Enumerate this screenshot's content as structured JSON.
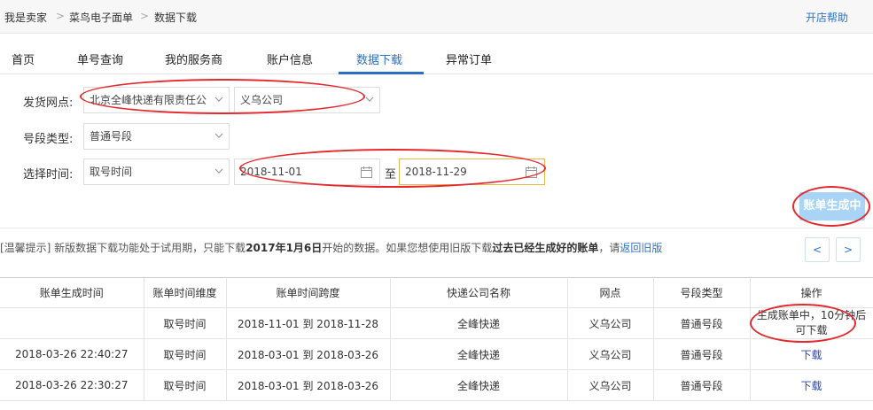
{
  "breadcrumb": {
    "items": [
      "我是卖家",
      "菜鸟电子面单",
      "数据下载"
    ],
    "separator": ">"
  },
  "help_link": "开店帮助",
  "tabs": [
    {
      "label": "首页"
    },
    {
      "label": "单号查询"
    },
    {
      "label": "我的服务商"
    },
    {
      "label": "账户信息"
    },
    {
      "label": "数据下载",
      "active": true
    },
    {
      "label": "异常订单"
    }
  ],
  "form": {
    "network_label": "发货网点:",
    "network_value": "北京全峰快递有限责任公",
    "branch_value": "义乌公司",
    "segment_label": "号段类型:",
    "segment_value": "普通号段",
    "time_label": "选择时间:",
    "time_type_value": "取号时间",
    "date_from": "2018-11-01",
    "to_label": "至",
    "date_to": "2018-11-29"
  },
  "generate_button": "账单生成中",
  "tip": {
    "prefix": "[温馨提示] 新版数据下载功能处于试用期，只能下载",
    "bold_date": "2017年1月6日",
    "middle": "开始的数据。如果您想使用旧版下载",
    "bold_old": "过去已经生成好的账单",
    "suffix": "，请",
    "link": "返回旧版"
  },
  "pager": {
    "prev": "<",
    "next": ">"
  },
  "table": {
    "headers": [
      "账单生成时间",
      "账单时间维度",
      "账单时间跨度",
      "快递公司名称",
      "网点",
      "号段类型",
      "操作"
    ],
    "rows": [
      [
        "",
        "取号时间",
        "2018-11-01 到 2018-11-28",
        "全峰快递",
        "义乌公司",
        "普通号段",
        "生成账单中，10分钟后可下载"
      ],
      [
        "2018-03-26 22:40:27",
        "取号时间",
        "2018-03-01 到 2018-03-26",
        "全峰快递",
        "义乌公司",
        "普通号段",
        "下载"
      ],
      [
        "2018-03-26 22:30:27",
        "取号时间",
        "2018-03-01 到 2018-03-26",
        "全峰快递",
        "义乌公司",
        "普通号段",
        "下载"
      ]
    ]
  },
  "colors": {
    "accent": "#2b6fc4",
    "button_disabled": "#a9d4f6",
    "annotation": "#e4292e",
    "focus_border": "#e6b650"
  }
}
